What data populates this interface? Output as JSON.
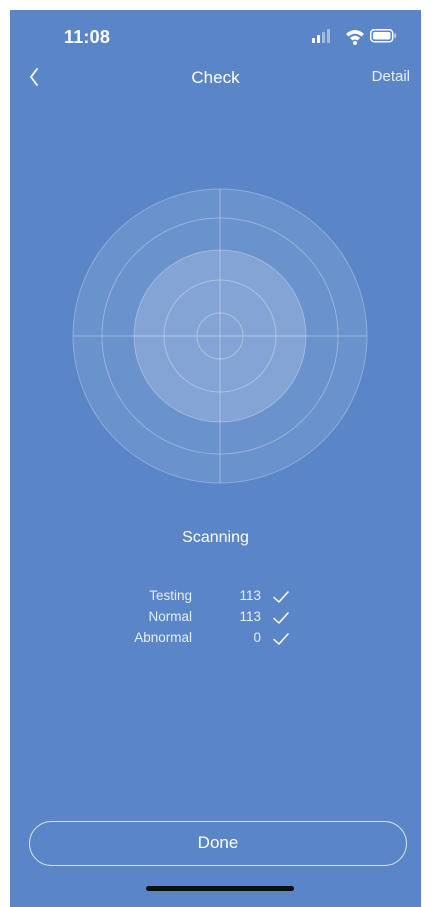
{
  "status_bar": {
    "time": "11:08",
    "icons": [
      "cellular-signal-icon",
      "wifi-icon",
      "battery-icon"
    ]
  },
  "nav": {
    "back_icon": "chevron-left-icon",
    "title": "Check",
    "detail_label": "Detail"
  },
  "radar": {
    "icon": "radar-scan-graphic"
  },
  "scan": {
    "status": "Scanning"
  },
  "stats": [
    {
      "label": "Testing",
      "value": "113",
      "icon": "checkmark-icon"
    },
    {
      "label": "Normal",
      "value": "113",
      "icon": "checkmark-icon"
    },
    {
      "label": "Abnormal",
      "value": "0",
      "icon": "checkmark-icon"
    }
  ],
  "footer": {
    "done_label": "Done"
  },
  "colors": {
    "background": "#5a86c8",
    "text": "#ffffff",
    "radar_inner": "#7aa2d8",
    "home_indicator": "#0d0d0d"
  }
}
